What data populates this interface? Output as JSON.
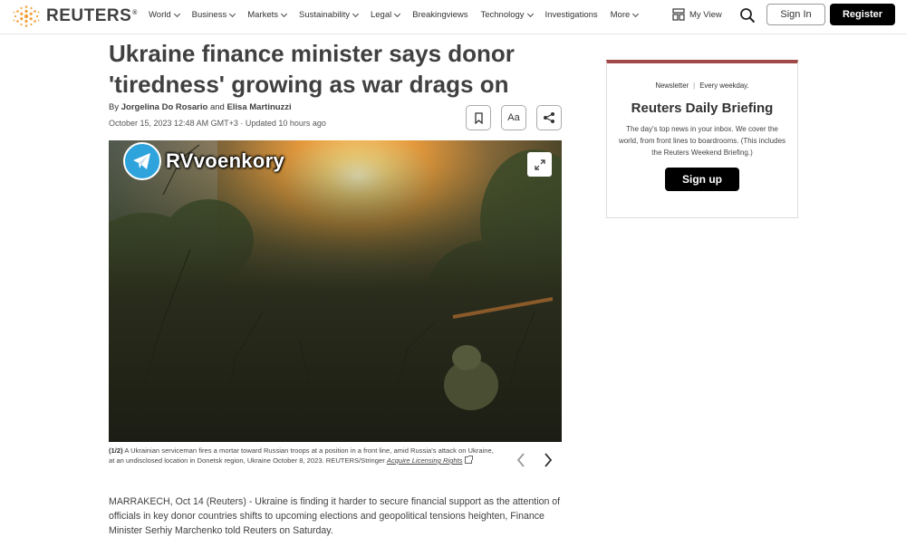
{
  "brand": {
    "name": "REUTERS",
    "reg": "®"
  },
  "nav": {
    "items": [
      {
        "label": "World",
        "has_menu": true
      },
      {
        "label": "Business",
        "has_menu": true
      },
      {
        "label": "Markets",
        "has_menu": true
      },
      {
        "label": "Sustainability",
        "has_menu": true
      },
      {
        "label": "Legal",
        "has_menu": true
      },
      {
        "label": "Breakingviews",
        "has_menu": false
      },
      {
        "label": "Technology",
        "has_menu": true
      },
      {
        "label": "Investigations",
        "has_menu": false
      },
      {
        "label": "More",
        "has_menu": true
      }
    ],
    "my_view": "My View",
    "search_icon": "search-icon",
    "sign_in": "Sign In",
    "register": "Register"
  },
  "article": {
    "headline": "Ukraine finance minister says donor 'tiredness' growing as war drags on",
    "byline_prefix": "By",
    "author1": "Jorgelina Do Rosario",
    "byline_and": "and",
    "author2": "Elisa Martinuzzi",
    "date": "October 15, 2023 12:48 AM GMT+3 · Updated 10 hours ago",
    "tools": {
      "bookmark_icon": "bookmark-icon",
      "font_size_label": "Aa",
      "share_icon": "share-icon"
    },
    "image": {
      "watermark": "RVvoenkory",
      "watermark_icon": "telegram-icon",
      "expand_icon": "expand-icon"
    },
    "caption": {
      "counter": "(1/2)",
      "text": "A Ukrainian serviceman fires a mortar toward Russian troops at a position in a front line, amid Russia's attack on Ukraine, at an undisclosed location in Donetsk region, Ukraine October 8, 2023. REUTERS/Stringer",
      "link": "Acquire Licensing Rights"
    },
    "gallery": {
      "prev_icon": "chevron-left-icon",
      "next_icon": "chevron-right-icon"
    },
    "body": "MARRAKECH, Oct 14 (Reuters) - Ukraine is finding it harder to secure financial support as the attention of officials in key donor countries shifts to upcoming elections and geopolitical tensions heighten, Finance Minister Serhiy Marchenko told Reuters on Saturday."
  },
  "newsletter": {
    "tag": "Newsletter",
    "frequency": "Every weekday.",
    "title": "Reuters Daily Briefing",
    "description": "The day's top news in your inbox. We cover the world, from front lines to boardrooms. (This includes the Reuters Weekend Briefing.)",
    "button": "Sign up",
    "accent_color": "#a04a48"
  },
  "colors": {
    "brand_orange": "#f2a13b",
    "telegram_blue": "#2ea3dc"
  }
}
